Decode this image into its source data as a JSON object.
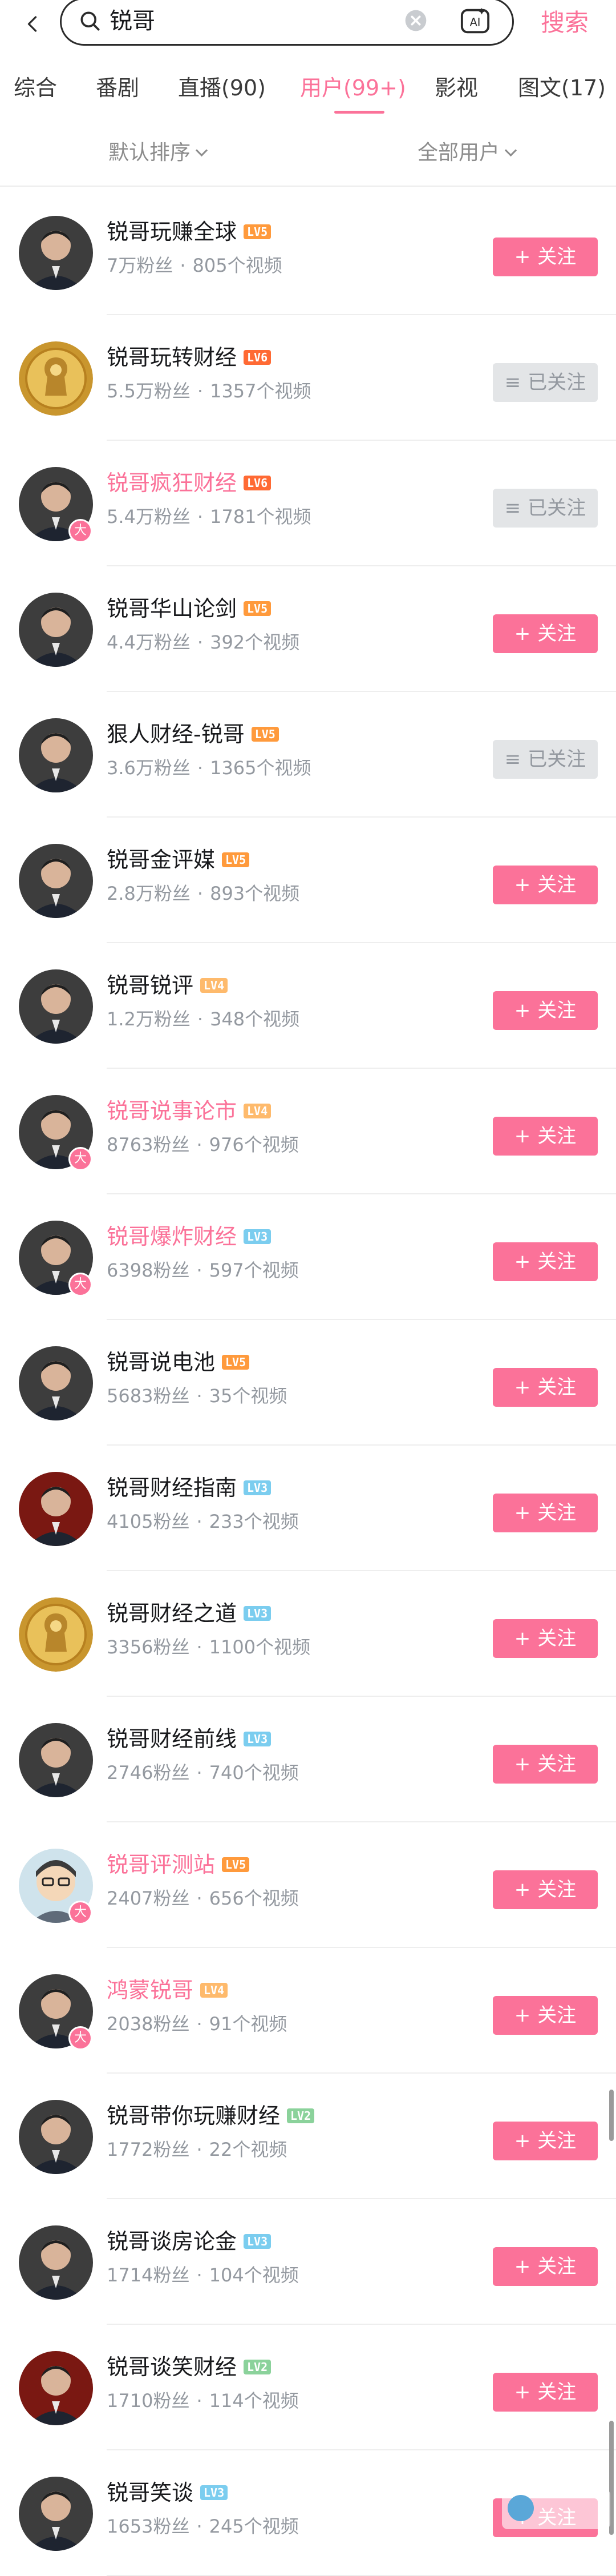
{
  "search": {
    "query": "锐哥",
    "submit_label": "搜索"
  },
  "tabs": [
    {
      "label": "综合"
    },
    {
      "label": "番剧"
    },
    {
      "label": "直播(90)"
    },
    {
      "label": "用户(99+)"
    },
    {
      "label": "影视"
    },
    {
      "label": "图文(17)"
    }
  ],
  "filters": {
    "sort": "默认排序",
    "scope": "全部用户"
  },
  "buttons": {
    "follow": "关注",
    "followed": "已关注"
  },
  "brand": {
    "accent": "#fb7299",
    "followed_bg": "#e3e5e7",
    "text_secondary": "#9499a0"
  },
  "users": [
    {
      "name": "锐哥玩赚全球",
      "level": "LV5",
      "fans": "7万粉丝",
      "videos": "805个视频",
      "followed": false,
      "vip": false,
      "badge": ""
    },
    {
      "name": "锐哥玩转财经",
      "level": "LV6",
      "fans": "5.5万粉丝",
      "videos": "1357个视频",
      "followed": true,
      "vip": false,
      "badge": ""
    },
    {
      "name": "锐哥疯狂财经",
      "level": "LV6",
      "fans": "5.4万粉丝",
      "videos": "1781个视频",
      "followed": true,
      "vip": true,
      "badge": "大"
    },
    {
      "name": "锐哥华山论剑",
      "level": "LV5",
      "fans": "4.4万粉丝",
      "videos": "392个视频",
      "followed": false,
      "vip": false,
      "badge": ""
    },
    {
      "name": "狠人财经-锐哥",
      "level": "LV5",
      "fans": "3.6万粉丝",
      "videos": "1365个视频",
      "followed": true,
      "vip": false,
      "badge": ""
    },
    {
      "name": "锐哥金评媒",
      "level": "LV5",
      "fans": "2.8万粉丝",
      "videos": "893个视频",
      "followed": false,
      "vip": false,
      "badge": ""
    },
    {
      "name": "锐哥锐评",
      "level": "LV4",
      "fans": "1.2万粉丝",
      "videos": "348个视频",
      "followed": false,
      "vip": false,
      "badge": ""
    },
    {
      "name": "锐哥说事论市",
      "level": "LV4",
      "fans": "8763粉丝",
      "videos": "976个视频",
      "followed": false,
      "vip": true,
      "badge": "大"
    },
    {
      "name": "锐哥爆炸财经",
      "level": "LV3",
      "fans": "6398粉丝",
      "videos": "597个视频",
      "followed": false,
      "vip": true,
      "badge": "大"
    },
    {
      "name": "锐哥说电池",
      "level": "LV5",
      "fans": "5683粉丝",
      "videos": "35个视频",
      "followed": false,
      "vip": false,
      "badge": ""
    },
    {
      "name": "锐哥财经指南",
      "level": "LV3",
      "fans": "4105粉丝",
      "videos": "233个视频",
      "followed": false,
      "vip": false,
      "badge": ""
    },
    {
      "name": "锐哥财经之道",
      "level": "LV3",
      "fans": "3356粉丝",
      "videos": "1100个视频",
      "followed": false,
      "vip": false,
      "badge": ""
    },
    {
      "name": "锐哥财经前线",
      "level": "LV3",
      "fans": "2746粉丝",
      "videos": "740个视频",
      "followed": false,
      "vip": false,
      "badge": ""
    },
    {
      "name": "锐哥评测站",
      "level": "LV5",
      "fans": "2407粉丝",
      "videos": "656个视频",
      "followed": false,
      "vip": true,
      "badge": "大"
    },
    {
      "name": "鸿蒙锐哥",
      "level": "LV4",
      "fans": "2038粉丝",
      "videos": "91个视频",
      "followed": false,
      "vip": true,
      "badge": "大"
    },
    {
      "name": "锐哥带你玩赚财经",
      "level": "LV2",
      "fans": "1772粉丝",
      "videos": "22个视频",
      "followed": false,
      "vip": false,
      "badge": ""
    },
    {
      "name": "锐哥谈房论金",
      "level": "LV3",
      "fans": "1714粉丝",
      "videos": "104个视频",
      "followed": false,
      "vip": false,
      "badge": ""
    },
    {
      "name": "锐哥谈笑财经",
      "level": "LV2",
      "fans": "1710粉丝",
      "videos": "114个视频",
      "followed": false,
      "vip": false,
      "badge": ""
    },
    {
      "name": "锐哥笑谈",
      "level": "LV3",
      "fans": "1653粉丝",
      "videos": "245个视频",
      "followed": false,
      "vip": false,
      "badge": ""
    }
  ],
  "level_colors": {
    "LV2": "#8bd29b",
    "LV3": "#7bcdef",
    "LV4": "#feba6c",
    "LV5": "#ff9a3c",
    "LV6": "#ff6a34"
  },
  "avatar_styles": [
    "portrait-dark",
    "gold-emblem",
    "portrait-dark",
    "portrait-dark",
    "portrait-dark",
    "portrait-dark",
    "portrait-dark",
    "portrait-dark",
    "portrait-dark",
    "portrait-dark",
    "portrait-red",
    "gold-emblem",
    "portrait-dark",
    "cartoon",
    "portrait-dark",
    "portrait-dark",
    "portrait-dark",
    "portrait-red",
    "portrait-dark"
  ]
}
